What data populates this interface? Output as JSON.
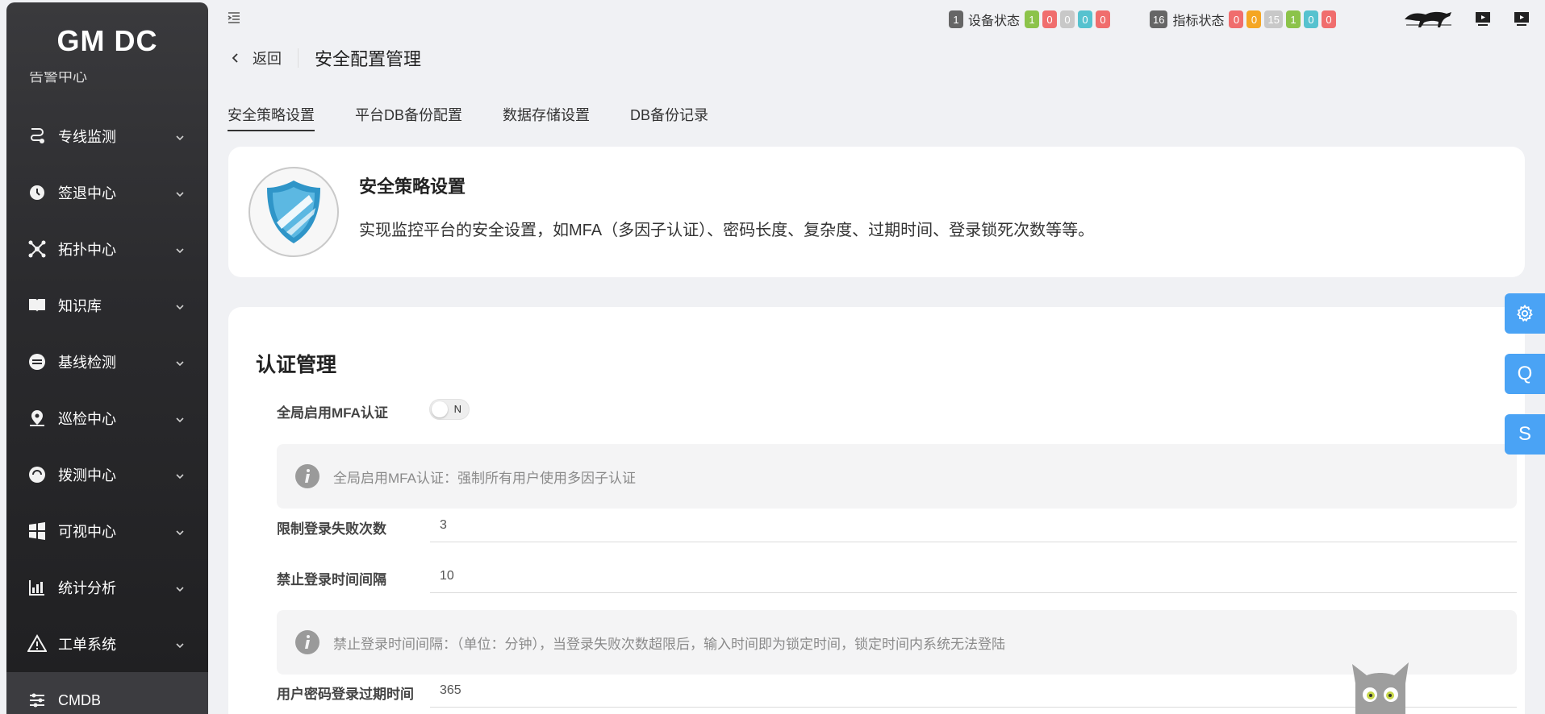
{
  "app": {
    "brand": "GM DC"
  },
  "sidebar": {
    "partial_item": "告警中心",
    "items": [
      {
        "label": "专线监测",
        "icon": "route-icon",
        "has_children": true
      },
      {
        "label": "签退中心",
        "icon": "clock-icon",
        "has_children": true
      },
      {
        "label": "拓扑中心",
        "icon": "topology-icon",
        "has_children": true
      },
      {
        "label": "知识库",
        "icon": "book-icon",
        "has_children": true
      },
      {
        "label": "基线检测",
        "icon": "keyboard-icon",
        "has_children": true
      },
      {
        "label": "巡检中心",
        "icon": "location-pin-icon",
        "has_children": true
      },
      {
        "label": "拨测中心",
        "icon": "dial-icon",
        "has_children": true
      },
      {
        "label": "可视中心",
        "icon": "windows-icon",
        "has_children": true
      },
      {
        "label": "统计分析",
        "icon": "bar-chart-icon",
        "has_children": true
      },
      {
        "label": "工单系统",
        "icon": "warning-icon",
        "has_children": true
      },
      {
        "label": "CMDB",
        "icon": "sliders-icon",
        "has_children": false
      }
    ]
  },
  "topbar": {
    "device_status": {
      "label": "设备状态",
      "total": "1",
      "badges": [
        {
          "value": "1",
          "color": "#8cc34a"
        },
        {
          "value": "0",
          "color": "#f06d6d"
        },
        {
          "value": "0",
          "color": "#c8c8c8"
        },
        {
          "value": "0",
          "color": "#56c2cf"
        },
        {
          "value": "0",
          "color": "#f06d6d"
        }
      ]
    },
    "indicator_status": {
      "label": "指标状态",
      "total": "16",
      "badges": [
        {
          "value": "0",
          "color": "#f06d6d"
        },
        {
          "value": "0",
          "color": "#f5a623"
        },
        {
          "value": "15",
          "color": "#c8c8c8"
        },
        {
          "value": "1",
          "color": "#8cc34a"
        },
        {
          "value": "0",
          "color": "#56c2cf"
        },
        {
          "value": "0",
          "color": "#f06d6d"
        }
      ]
    }
  },
  "header": {
    "back_label": "返回",
    "title": "安全配置管理"
  },
  "tabs": [
    {
      "label": "安全策略设置",
      "active": true
    },
    {
      "label": "平台DB备份配置",
      "active": false
    },
    {
      "label": "数据存储设置",
      "active": false
    },
    {
      "label": "DB备份记录",
      "active": false
    }
  ],
  "intro": {
    "title": "安全策略设置",
    "description": "实现监控平台的安全设置，如MFA（多因子认证）、密码长度、复杂度、过期时间、登录锁死次数等等。"
  },
  "auth": {
    "section_title": "认证管理",
    "mfa_label": "全局启用MFA认证",
    "mfa_toggle": "N",
    "mfa_info": "全局启用MFA认证：强制所有用户使用多因子认证",
    "fail_limit_label": "限制登录失败次数",
    "fail_limit_value": "3",
    "ban_interval_label": "禁止登录时间间隔",
    "ban_interval_value": "10",
    "ban_interval_info": "禁止登录时间间隔：（单位：分钟），当登录失败次数超限后，输入时间即为锁定时间，锁定时间内系统无法登陆",
    "pwd_expire_label": "用户密码登录过期时间",
    "pwd_expire_value": "365"
  },
  "floating": {
    "settings": "gear-icon",
    "q_label": "Q",
    "s_label": "S"
  },
  "colors": {
    "accent": "#4aa3f5",
    "sidebar_bg": "#2b2b2e"
  }
}
